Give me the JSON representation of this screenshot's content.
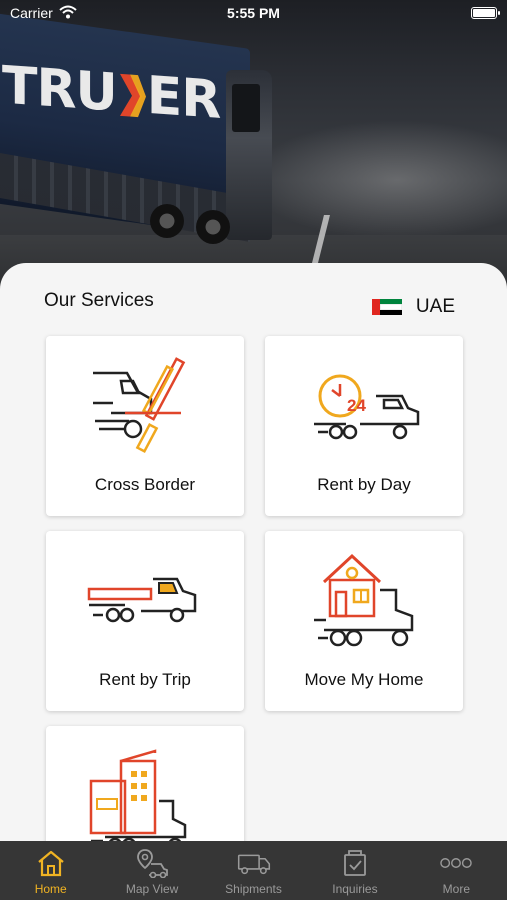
{
  "status_bar": {
    "carrier": "Carrier",
    "time": "5:55 PM"
  },
  "hero": {
    "brand_text_left": "TRU",
    "brand_text_right": "ER"
  },
  "services": {
    "title": "Our Services",
    "country": {
      "name": "UAE",
      "flag": "uae-flag"
    },
    "cards": [
      {
        "label": "Cross Border",
        "icon": "cross-border-icon"
      },
      {
        "label": "Rent by Day",
        "icon": "rent-by-day-icon",
        "badge": "24"
      },
      {
        "label": "Rent by Trip",
        "icon": "rent-by-trip-icon"
      },
      {
        "label": "Move My Home",
        "icon": "move-my-home-icon"
      },
      {
        "label": "",
        "icon": "commercial-move-icon"
      }
    ]
  },
  "tab_bar": {
    "tabs": [
      {
        "label": "Home",
        "icon": "home-icon",
        "active": true
      },
      {
        "label": "Map View",
        "icon": "map-view-icon",
        "active": false
      },
      {
        "label": "Shipments",
        "icon": "shipments-icon",
        "active": false
      },
      {
        "label": "Inquiries",
        "icon": "inquiries-icon",
        "active": false
      },
      {
        "label": "More",
        "icon": "more-icon",
        "active": false
      }
    ]
  },
  "colors": {
    "accent": "#f0b323",
    "brand_red": "#e0452a",
    "brand_orange": "#f0a81e",
    "tab_bg": "#363636",
    "sheet_bg": "#f5f5f5"
  }
}
